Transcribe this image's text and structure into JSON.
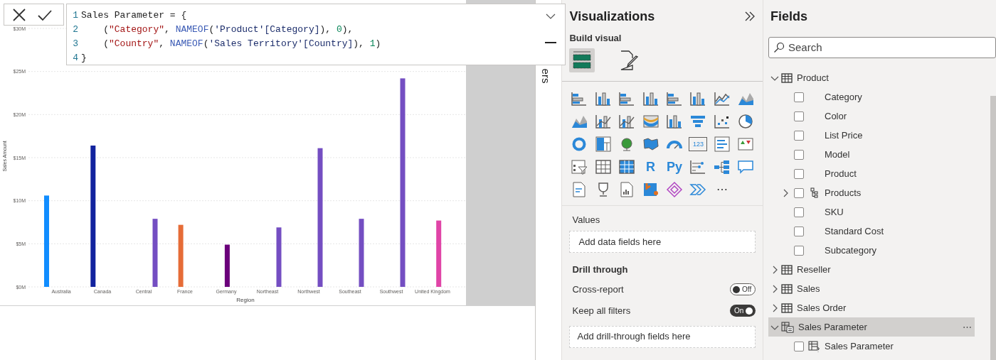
{
  "formula_bar": {
    "lines": [
      {
        "number": "1",
        "tokens": [
          {
            "kind": "plain",
            "t": "Sales Parameter = {"
          }
        ]
      },
      {
        "number": "2",
        "tokens": [
          {
            "kind": "plain",
            "t": "    ("
          },
          {
            "kind": "string",
            "t": "\"Category\""
          },
          {
            "kind": "plain",
            "t": ", "
          },
          {
            "kind": "function",
            "t": "NAMEOF"
          },
          {
            "kind": "plain",
            "t": "("
          },
          {
            "kind": "ref",
            "t": "'Product'[Category]"
          },
          {
            "kind": "plain",
            "t": "), "
          },
          {
            "kind": "number",
            "t": "0"
          },
          {
            "kind": "plain",
            "t": "),"
          }
        ]
      },
      {
        "number": "3",
        "tokens": [
          {
            "kind": "plain",
            "t": "    ("
          },
          {
            "kind": "string",
            "t": "\"Country\""
          },
          {
            "kind": "plain",
            "t": ", "
          },
          {
            "kind": "function",
            "t": "NAMEOF"
          },
          {
            "kind": "plain",
            "t": "("
          },
          {
            "kind": "ref",
            "t": "'Sales Territory'[Country]"
          },
          {
            "kind": "plain",
            "t": "), "
          },
          {
            "kind": "number",
            "t": "1"
          },
          {
            "kind": "plain",
            "t": ")"
          }
        ]
      },
      {
        "number": "4",
        "tokens": [
          {
            "kind": "plain",
            "t": "}"
          }
        ]
      }
    ]
  },
  "filters_pane": {
    "label": "ers"
  },
  "chart_data": {
    "type": "bar",
    "xlabel": "Region",
    "ylabel": "Sales Amount",
    "stacked": false,
    "orientation": "vertical",
    "categories": [
      "Australia",
      "Canada",
      "Central",
      "France",
      "Germany",
      "Northeast",
      "Northwest",
      "Southeast",
      "Southwest",
      "United Kingdom"
    ],
    "yticks": [
      {
        "value": 0,
        "label": "$0M"
      },
      {
        "value": 5,
        "label": "$5M"
      },
      {
        "value": 10,
        "label": "$10M"
      },
      {
        "value": 15,
        "label": "$15M"
      },
      {
        "value": 20,
        "label": "$20M"
      },
      {
        "value": 25,
        "label": "$25M"
      },
      {
        "value": 30,
        "label": "$30M"
      }
    ],
    "ylim": [
      0,
      30
    ],
    "grid": true,
    "series": [
      {
        "color": "#118dff",
        "values": [
          10.6,
          null,
          null,
          null,
          null,
          null,
          null,
          null,
          null,
          null
        ]
      },
      {
        "color": "#12239e",
        "values": [
          null,
          16.4,
          null,
          null,
          null,
          null,
          null,
          null,
          null,
          null
        ]
      },
      {
        "color": "#e66c37",
        "values": [
          null,
          null,
          null,
          7.2,
          null,
          null,
          null,
          null,
          null,
          null
        ]
      },
      {
        "color": "#6b007b",
        "values": [
          null,
          null,
          null,
          null,
          4.9,
          null,
          null,
          null,
          null,
          null
        ]
      },
      {
        "color": "#e044a7",
        "values": [
          null,
          null,
          null,
          null,
          null,
          null,
          null,
          null,
          null,
          7.7
        ]
      },
      {
        "color": "#744ec2",
        "values": [
          null,
          null,
          7.9,
          null,
          null,
          6.9,
          16.1,
          7.9,
          24.2,
          null
        ]
      }
    ]
  },
  "visualizations": {
    "title": "Visualizations",
    "subtitle": "Build visual",
    "tabs": [
      {
        "kind": "fields",
        "selected": true
      },
      {
        "kind": "format",
        "selected": false
      }
    ],
    "visual_types": [
      {
        "kind": "hbar"
      },
      {
        "kind": "vbar"
      },
      {
        "kind": "hbar"
      },
      {
        "kind": "vbar"
      },
      {
        "kind": "hbar"
      },
      {
        "kind": "vbar"
      },
      {
        "kind": "line"
      },
      {
        "kind": "area"
      },
      {
        "kind": "area"
      },
      {
        "kind": "combo"
      },
      {
        "kind": "combo"
      },
      {
        "kind": "ribbon"
      },
      {
        "kind": "vbar"
      },
      {
        "kind": "funnel"
      },
      {
        "kind": "scatter"
      },
      {
        "kind": "pie"
      },
      {
        "kind": "donut"
      },
      {
        "kind": "treemap"
      },
      {
        "kind": "globe"
      },
      {
        "kind": "map"
      },
      {
        "kind": "gauge"
      },
      {
        "kind": "card",
        "text": "123"
      },
      {
        "kind": "multirow"
      },
      {
        "kind": "kpi"
      },
      {
        "kind": "slicer"
      },
      {
        "kind": "table"
      },
      {
        "kind": "matrix"
      },
      {
        "kind": "glyph",
        "text": "R"
      },
      {
        "kind": "glyph",
        "text": "Py"
      },
      {
        "kind": "influencers"
      },
      {
        "kind": "decomposition"
      },
      {
        "kind": "bubble"
      },
      {
        "kind": "narrative"
      },
      {
        "kind": "trophy"
      },
      {
        "kind": "paginated"
      },
      {
        "kind": "azuremap"
      },
      {
        "kind": "diamond"
      },
      {
        "kind": "chevrons"
      },
      {
        "kind": "more",
        "text": "⋯"
      }
    ],
    "values_label": "Values",
    "values_placeholder": "Add data fields here",
    "drill_title": "Drill through",
    "toggles": [
      {
        "label": "Cross-report",
        "on": false,
        "state_text": "Off"
      },
      {
        "label": "Keep all filters",
        "on": true,
        "state_text": "On"
      }
    ],
    "drill_placeholder": "Add drill-through fields here"
  },
  "fields": {
    "title": "Fields",
    "search": {
      "placeholder": "Search"
    },
    "tables": [
      {
        "name": "Product",
        "kind": "table",
        "expanded": true,
        "selected": false,
        "children": [
          {
            "name": "Category",
            "kind": "column",
            "checked": false
          },
          {
            "name": "Color",
            "kind": "column",
            "checked": false
          },
          {
            "name": "List Price",
            "kind": "column",
            "checked": false
          },
          {
            "name": "Model",
            "kind": "column",
            "checked": false
          },
          {
            "name": "Product",
            "kind": "column",
            "checked": false
          },
          {
            "name": "Products",
            "kind": "hierarchy",
            "checked": false,
            "expanded": false
          },
          {
            "name": "SKU",
            "kind": "column",
            "checked": false
          },
          {
            "name": "Standard Cost",
            "kind": "column",
            "checked": false
          },
          {
            "name": "Subcategory",
            "kind": "column",
            "checked": false
          }
        ]
      },
      {
        "name": "Reseller",
        "kind": "table",
        "expanded": false,
        "selected": false
      },
      {
        "name": "Sales",
        "kind": "table",
        "expanded": false,
        "selected": false
      },
      {
        "name": "Sales Order",
        "kind": "table",
        "expanded": false,
        "selected": false
      },
      {
        "name": "Sales Parameter",
        "kind": "parameter",
        "expanded": true,
        "selected": true,
        "more": "⋯",
        "children": [
          {
            "name": "Sales Parameter",
            "kind": "field-parameter",
            "checked": false
          }
        ]
      }
    ]
  }
}
